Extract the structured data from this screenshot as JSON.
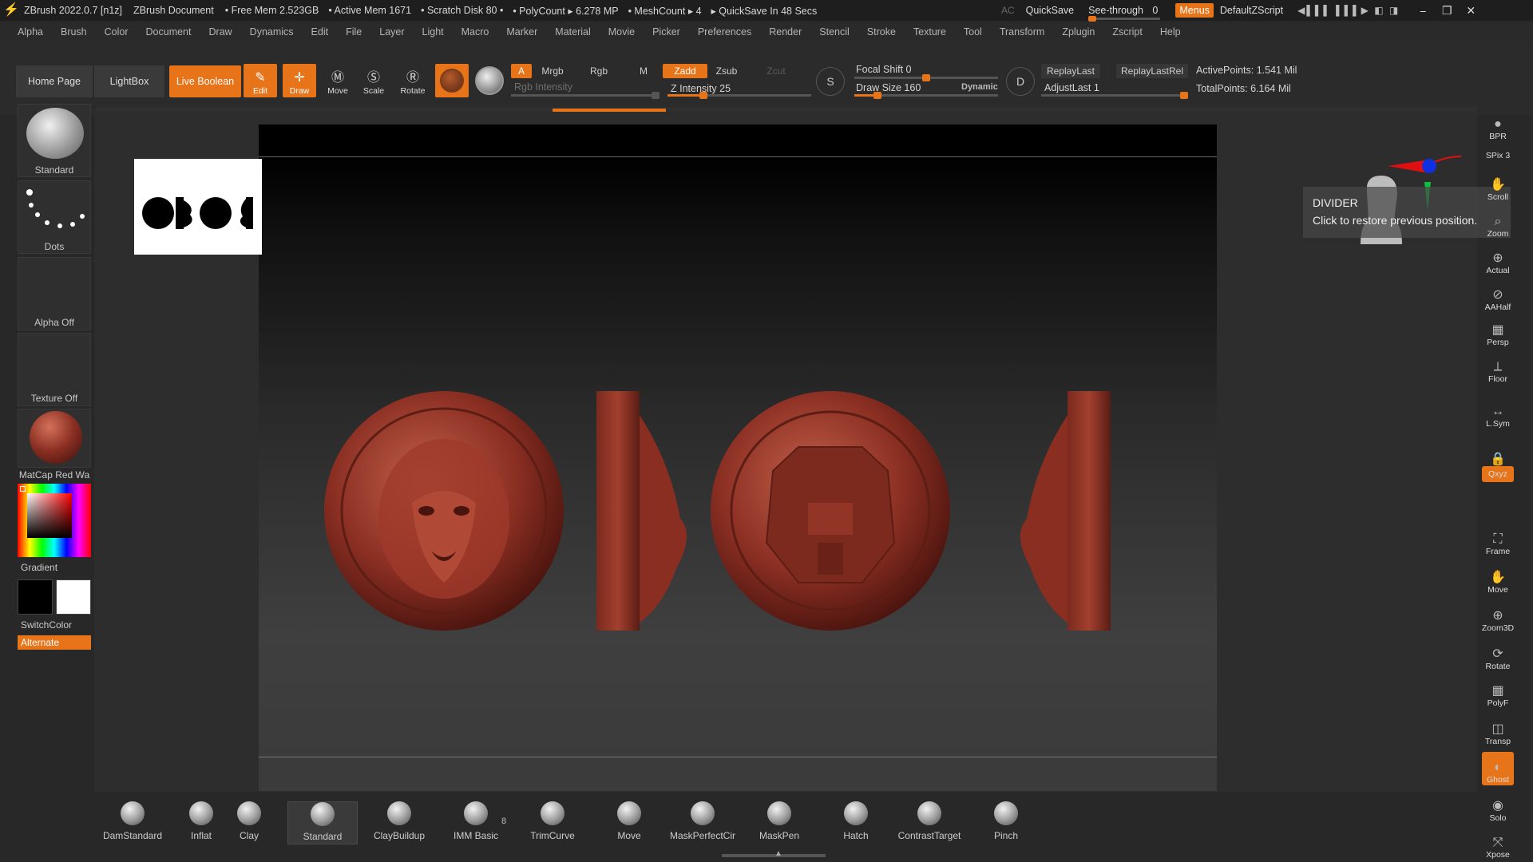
{
  "titlebar": {
    "app_title": "ZBrush 2022.0.7 [n1z]",
    "document": "ZBrush Document",
    "free_mem": "• Free Mem 2.523GB",
    "active_mem": "• Active Mem 1671",
    "scratch": "• Scratch Disk 80 •",
    "polycount": "• PolyCount ▸ 6.278 MP",
    "meshcount": "• MeshCount ▸ 4",
    "quicksave_info": "▸ QuickSave In 48 Secs",
    "ac": "AC",
    "quicksave": "QuickSave",
    "see_through": "See-through",
    "see_through_value": "0",
    "menus": "Menus",
    "zscript": "DefaultZScript",
    "minimize": "⎯",
    "restore": "❐",
    "close": "✕"
  },
  "menu": [
    "Alpha",
    "Brush",
    "Color",
    "Document",
    "Draw",
    "Dynamics",
    "Edit",
    "File",
    "Layer",
    "Light",
    "Macro",
    "Marker",
    "Material",
    "Movie",
    "Picker",
    "Preferences",
    "Render",
    "Stencil",
    "Stroke",
    "Texture",
    "Tool",
    "Transform",
    "Zplugin",
    "Zscript",
    "Help"
  ],
  "shelf": {
    "home_page": "Home Page",
    "lightbox": "LightBox",
    "live_boolean": "Live Boolean",
    "edit": "Edit",
    "draw": "Draw",
    "move": "Move",
    "scale": "Scale",
    "rotate": "Rotate",
    "a": "A",
    "mrgb": "Mrgb",
    "rgb": "Rgb",
    "m": "M",
    "zadd": "Zadd",
    "zsub": "Zsub",
    "zcut": "Zcut",
    "rgb_intensity": "Rgb Intensity",
    "z_intensity": "Z Intensity 25",
    "focal_shift": "Focal Shift 0",
    "draw_size": "Draw Size 160",
    "dynamic": "Dynamic",
    "replay_last": "ReplayLast",
    "replay_last_rel": "ReplayLastRel",
    "adjust_last": "AdjustLast 1",
    "active_points": "ActivePoints: 1.541 Mil",
    "total_points": "TotalPoints: 6.164 Mil",
    "z_intensity_level": 0.25,
    "focal_shift_level": 0.5,
    "draw_size_level": 0.16,
    "adjust_last_level": 1.0
  },
  "left_panel": {
    "brush_label": "Standard",
    "stroke_label": "Dots",
    "alpha_label": "Alpha Off",
    "texture_label": "Texture Off",
    "material_label": "MatCap Red Wa",
    "gradient_label": "Gradient",
    "switch_color_label": "SwitchColor",
    "alternate_label": "Alternate"
  },
  "right_panel": [
    {
      "name": "bpr",
      "label": "BPR"
    },
    {
      "name": "spix",
      "label": "SPix 3"
    },
    {
      "name": "scroll",
      "label": "Scroll"
    },
    {
      "name": "zoom",
      "label": "Zoom"
    },
    {
      "name": "actual",
      "label": "Actual"
    },
    {
      "name": "aahalf",
      "label": "AAHalf"
    },
    {
      "name": "persp",
      "label": "Persp"
    },
    {
      "name": "floor",
      "label": "Floor"
    },
    {
      "name": "lsym",
      "label": "L.Sym"
    },
    {
      "name": "lock",
      "label": ""
    },
    {
      "name": "qxyz",
      "label": "Qxyz"
    },
    {
      "name": "frame",
      "label": "Frame"
    },
    {
      "name": "move",
      "label": "Move"
    },
    {
      "name": "zoom3d",
      "label": "Zoom3D"
    },
    {
      "name": "rotate",
      "label": "Rotate"
    },
    {
      "name": "polyf",
      "label": "PolyF"
    },
    {
      "name": "transp",
      "label": "Transp"
    },
    {
      "name": "ghost",
      "label": "Ghost"
    },
    {
      "name": "solo",
      "label": "Solo"
    },
    {
      "name": "xpose",
      "label": "Xpose"
    }
  ],
  "tooltip": {
    "title": "DIVIDER",
    "text": "Click to restore previous position."
  },
  "brushes": [
    {
      "label": "DamStandard"
    },
    {
      "label": "Inflat"
    },
    {
      "label": "Clay"
    },
    {
      "label": "Standard"
    },
    {
      "label": "ClayBuildup"
    },
    {
      "label": "IMM Basic"
    },
    {
      "label": "TrimCurve"
    },
    {
      "label": "Move"
    },
    {
      "label": "MaskPerfectCir"
    },
    {
      "label": "MaskPen"
    },
    {
      "label": "Hatch"
    },
    {
      "label": "ContrastTarget"
    },
    {
      "label": "Pinch"
    }
  ],
  "imm_count": "8",
  "colors": {
    "accent": "#e8741a",
    "model": "#8a2e22"
  }
}
